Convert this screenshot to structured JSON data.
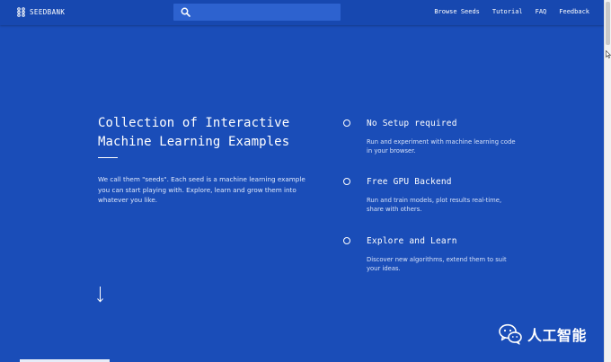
{
  "navbar": {
    "logo_text": "SEEDBANK",
    "search": {
      "value": "",
      "placeholder": ""
    },
    "links": [
      "Browse Seeds",
      "Tutorial",
      "FAQ",
      "Feedback"
    ]
  },
  "hero": {
    "title_lines": [
      "Collection of Interactive",
      "Machine Learning Examples"
    ],
    "description": "We call them \"seeds\". Each seed is a machine learning example you can start playing with. Explore, learn and grow them into whatever you like."
  },
  "features": [
    {
      "title": "No Setup required",
      "description": "Run and experiment with machine learning code in your browser."
    },
    {
      "title": "Free GPU Backend",
      "description": "Run and train models, plot results real-time, share with others."
    },
    {
      "title": "Explore and Learn",
      "description": "Discover new algorithms, extend them to suit your ideas."
    }
  ],
  "watermark": {
    "text": "人工智能"
  },
  "colors": {
    "background": "#1a4db8",
    "navbar": "#1748b0",
    "search_bg": "#2d62cf",
    "text": "#ffffff",
    "muted_text": "#d6e1f8"
  },
  "icons": {
    "logo": "seedbank-logo-icon",
    "search": "search-icon",
    "feature_bullet": "circle-outline-icon",
    "scroll_hint": "arrow-down-icon",
    "watermark": "wechat-icon"
  }
}
